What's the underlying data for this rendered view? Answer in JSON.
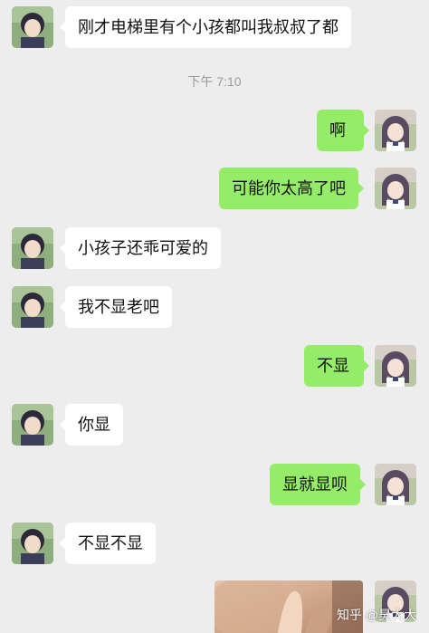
{
  "messages": [
    {
      "side": "in",
      "text": "刚才电梯里有个小孩都叫我叔叔了都"
    },
    {
      "side": "out",
      "text": "啊"
    },
    {
      "side": "out",
      "text": "可能你太高了吧"
    },
    {
      "side": "in",
      "text": "小孩子还乖可爱的"
    },
    {
      "side": "in",
      "text": "我不显老吧"
    },
    {
      "side": "out",
      "text": "不显"
    },
    {
      "side": "in",
      "text": "你显"
    },
    {
      "side": "out",
      "text": "显就显呗"
    },
    {
      "side": "in",
      "text": "不显不显"
    }
  ],
  "timestamp": "下午 7:10",
  "watermark": "知乎 @昊大大",
  "colors": {
    "background": "#ededed",
    "incoming_bubble": "#ffffff",
    "outgoing_bubble": "#95ec69",
    "timestamp_text": "#9a9a9a"
  },
  "icons": {
    "incoming_avatar": "anime-boy-avatar-icon",
    "outgoing_avatar": "anime-girl-avatar-icon"
  }
}
